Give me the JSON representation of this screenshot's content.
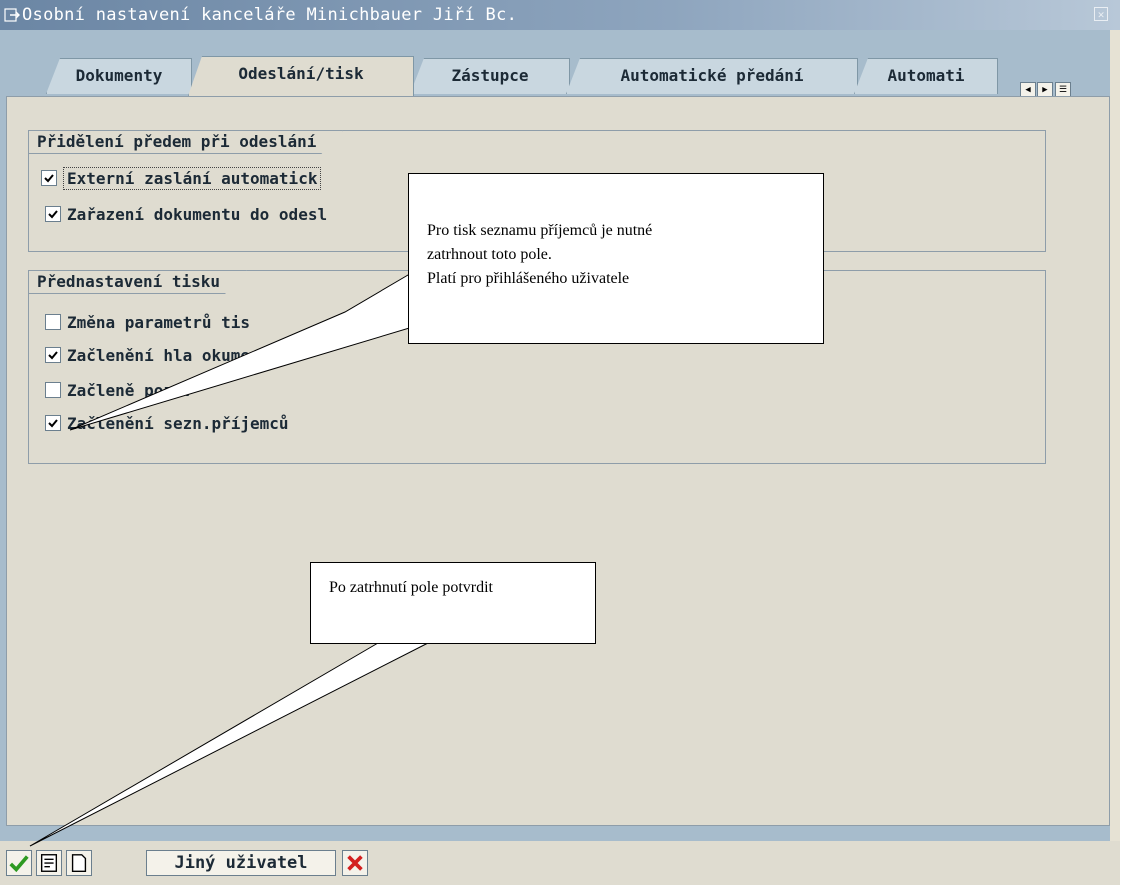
{
  "window": {
    "title": "Osobní nastavení kanceláře Minichbauer Jiří Bc."
  },
  "tabs": [
    {
      "label": "Dokumenty",
      "active": false
    },
    {
      "label": "Odeslání/tisk",
      "active": true
    },
    {
      "label": "Zástupce",
      "active": false
    },
    {
      "label": "Automatické předání",
      "active": false
    },
    {
      "label": "Automati",
      "active": false
    }
  ],
  "groups": {
    "send": {
      "title": "Přidělení předem při odeslání",
      "items": [
        {
          "label": "Externí zaslání automatick",
          "checked": true
        },
        {
          "label": "Zařazení dokumentu do odesl",
          "checked": true
        }
      ]
    },
    "print": {
      "title": "Přednastavení tisku",
      "items": [
        {
          "label": "Změna parametrů tis",
          "checked": false
        },
        {
          "label": "Začlenění hla    okumentu",
          "checked": true
        },
        {
          "label": "Začleně   pozn.",
          "checked": false
        },
        {
          "label": "Začlenění sezn.příjemců",
          "checked": true
        }
      ]
    }
  },
  "callouts": {
    "top": {
      "line1": "Pro tisk seznamu příjemců je nutné",
      "line2": " zatrhnout toto pole.",
      "line3": "Platí pro přihlášeného uživatele"
    },
    "bottom": {
      "text": "Po zatrhnutí pole potvrdit"
    }
  },
  "toolbar": {
    "other_user_label": "Jiný uživatel"
  },
  "colors": {
    "frame": "#a7bccc",
    "panel": "#dfdcd0",
    "title_gradient_start": "#6b86a4",
    "confirm_green": "#2e9a22",
    "cancel_red": "#d32020"
  }
}
